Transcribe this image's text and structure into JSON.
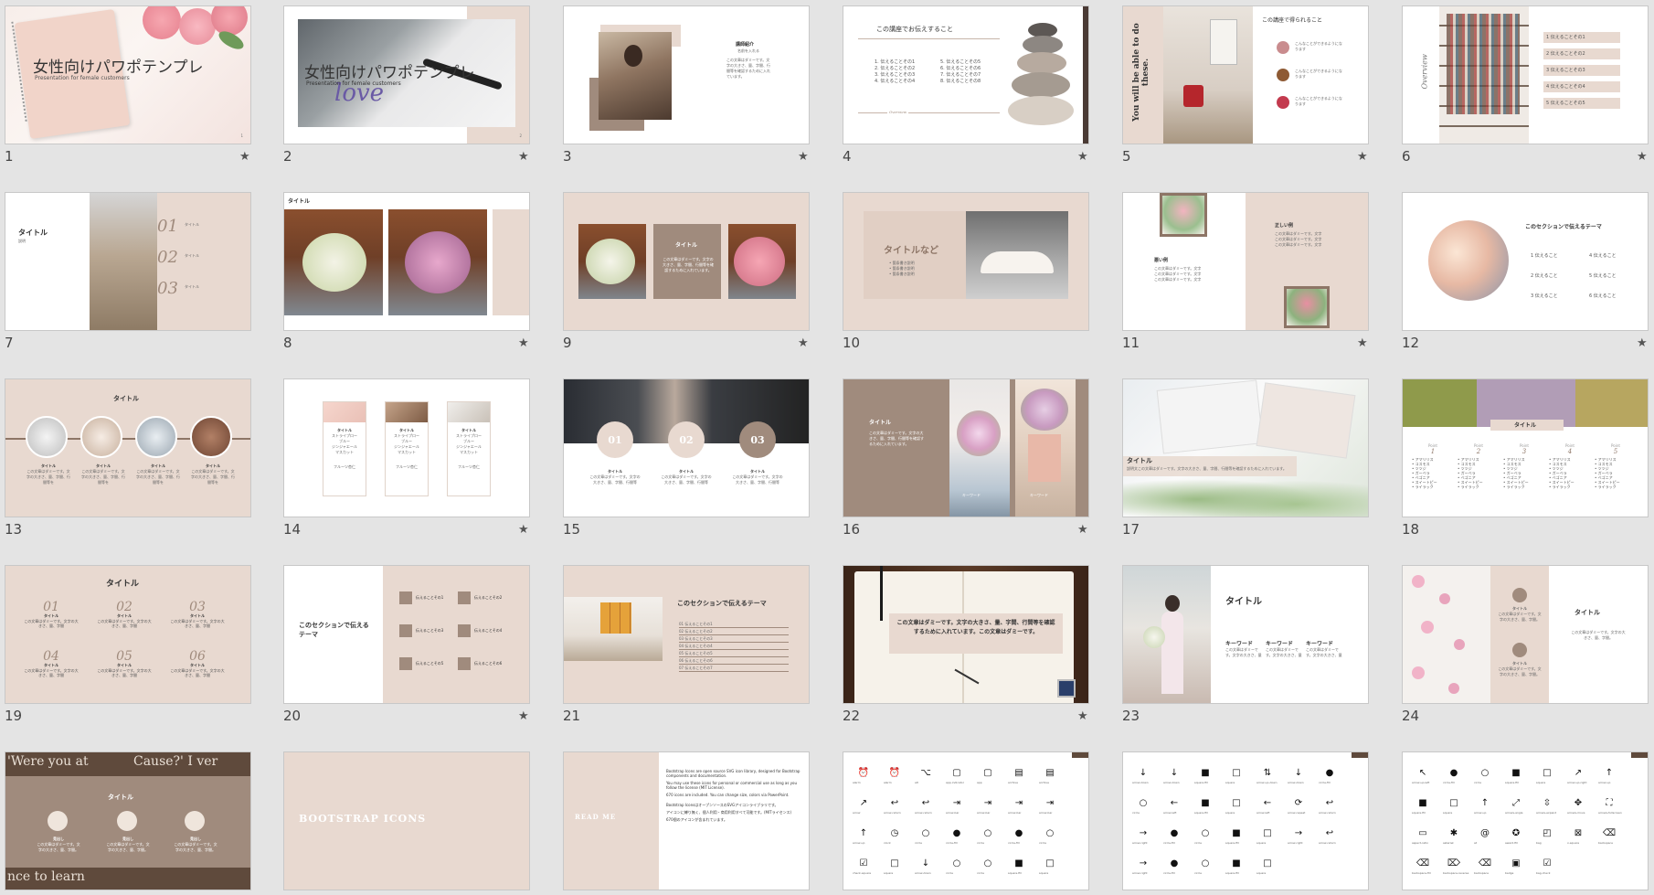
{
  "slides": [
    {
      "num": "1",
      "title": "女性向けパワポテンプレ",
      "subtitle": "Presentation for female customers",
      "page": "1"
    },
    {
      "num": "2",
      "title": "女性向けパワポテンプレ",
      "subtitle": "Presentation for female customers",
      "page": "2"
    },
    {
      "num": "3",
      "heading": "講師紹介",
      "sub": "名前を入れる",
      "body": "この文章はダミーです。文字の大きさ、量、字間、行間等を確認するために入れています。"
    },
    {
      "num": "4",
      "heading": "この講座でお伝えすること",
      "items_left": [
        "1. 伝えることその1",
        "2. 伝えることその2",
        "3. 伝えることその3",
        "4. 伝えることその4"
      ],
      "items_right": [
        "5. 伝えることその5",
        "6. 伝えることその6",
        "7. 伝えることその7",
        "8. 伝えることその8"
      ],
      "footer": "Overview"
    },
    {
      "num": "5",
      "side": "You will be able to do these.",
      "heading": "この講座で得られること",
      "items": [
        "こんなことができるようになります",
        "こんなことができるようになります",
        "こんなことができるようになります"
      ]
    },
    {
      "num": "6",
      "side": "Overview",
      "items": [
        "1 伝えることその1",
        "2 伝えることその2",
        "3 伝えることその3",
        "4 伝えることその4",
        "5 伝えることその5"
      ]
    },
    {
      "num": "7",
      "title": "タイトル",
      "sub": "説明",
      "items": [
        "01",
        "02",
        "03"
      ],
      "item_label": "タイトル"
    },
    {
      "num": "8",
      "title": "タイトル"
    },
    {
      "num": "9",
      "title": "タイトル",
      "body": "この文章はダミーです。文字の大きさ、量、字間、行間等を確認するために入れています。"
    },
    {
      "num": "10",
      "title": "タイトルなど",
      "items": [
        "箇条書き説明",
        "箇条書き説明",
        "箇条書き説明"
      ]
    },
    {
      "num": "11",
      "bad": "悪い例",
      "good": "正しい例",
      "line": "この文章はダミーです。文字"
    },
    {
      "num": "12",
      "heading": "このセクションで伝えるテーマ",
      "items": [
        "1 伝えること",
        "2 伝えること",
        "3 伝えること",
        "4 伝えること",
        "5 伝えること",
        "6 伝えること"
      ]
    },
    {
      "num": "13",
      "title": "タイトル",
      "label": "タイトル",
      "body": "この文章はダミーです。文字の大きさ、量、字間、行間等を"
    },
    {
      "num": "14",
      "label": "タイトル",
      "lines": [
        "ストライプロー",
        "ブルー",
        "ジンジャエール",
        "マスカット"
      ],
      "footer": "フルーツ杏仁"
    },
    {
      "num": "15",
      "items": [
        "01",
        "02",
        "03"
      ],
      "label": "タイトル",
      "body": "この文章はダミーです。文字の大きさ、量、字間、行間等"
    },
    {
      "num": "16",
      "title": "タイトル",
      "body": "この文章はダミーです。文字の大きさ、量、字間、行間等を確認するために入れています。",
      "captions": [
        "キーワード",
        "キーワード"
      ]
    },
    {
      "num": "17",
      "title": "タイトル",
      "body": "説明文この文章はダミーです。文字の大きさ、量、字間、行間等を確認するために入れています。"
    },
    {
      "num": "18",
      "title": "タイトル",
      "cols": [
        "1",
        "2",
        "3",
        "4",
        "5"
      ],
      "col_head": "Point",
      "lines": [
        "アマリリス",
        "コスモス",
        "ツツジ",
        "ガーベラ",
        "ベゴニア",
        "スイートピー",
        "ライラック"
      ]
    },
    {
      "num": "19",
      "title": "タイトル",
      "items": [
        "01",
        "02",
        "03",
        "04",
        "05",
        "06"
      ],
      "label": "タイトル",
      "body": "この文章はダミーです。文字の大きさ、量、字間"
    },
    {
      "num": "20",
      "heading": "このセクションで伝えるテーマ",
      "items": [
        "伝えることその1",
        "伝えることその2",
        "伝えることその3",
        "伝えることその4",
        "伝えることその5",
        "伝えることその6"
      ]
    },
    {
      "num": "21",
      "heading": "このセクションで伝えるテーマ",
      "items": [
        "01 伝えることその1",
        "02 伝えることその2",
        "03 伝えることその3",
        "04 伝えることその4",
        "05 伝えることその5",
        "06 伝えることその6",
        "07 伝えることその7"
      ]
    },
    {
      "num": "22",
      "body": "この文章はダミーです。文字の大きさ、量、字間、行間等を確認するために入れています。この文章はダミーです。"
    },
    {
      "num": "23",
      "title": "タイトル",
      "kw": "キーワード",
      "body": "この文章はダミーです。文字の大きさ、量"
    },
    {
      "num": "24",
      "title": "タイトル",
      "label": "タイトル",
      "body": "この文章はダミーです。文字の大きさ、量、字間。"
    },
    {
      "num": "25",
      "title": "タイトル",
      "label": "見出し",
      "body": "この文章はダミーです。文字の大きさ、量、字間。",
      "bg_text_1": "'Were you at",
      "bg_text_2": "nce to learn",
      "bg_text_3": "Cause?' I ver"
    },
    {
      "num": "26",
      "title": "BOOTSTRAP ICONS"
    },
    {
      "num": "27",
      "title": "READ ME",
      "bullets": [
        "Bootstrap Icons are open source SVG icon library, designed for Bootstrap components and documentation.",
        "You may use these icons for personal or commercial use as long as you follow the license (MIT License).",
        "670 icons are included. You can change size, colors via PowerPoint.",
        "Bootstrap IconsはオープンソースのSVGアイコンライブラリです。",
        "アイコンに縛り無く、個人利用・商用利用すべて可能です。(MITライセンス)",
        "670個のアイコンが含まれています。"
      ]
    },
    {
      "num": "28",
      "icons": [
        "alarm",
        "alarm",
        "alt",
        "app-indicator",
        "app",
        "archive",
        "archive",
        "arrow",
        "arrow-return",
        "arrow-return",
        "arrow-bar",
        "arrow-bar",
        "arrow-bar",
        "arrow-bar",
        "arrow-up",
        "clock",
        "circle",
        "circle-fill",
        "circle",
        "circle-fill",
        "circle",
        "check-square",
        "square",
        "arrow-down",
        "circle",
        "circle",
        "square-fill",
        "square"
      ]
    },
    {
      "num": "29",
      "icons": [
        "arrow-down",
        "arrow-down",
        "square-fill",
        "square",
        "arrow-up-down",
        "arrow-down",
        "circle-fill",
        "circle",
        "arrow-left",
        "square-fill",
        "square",
        "arrow-left",
        "arrow-repeat",
        "arrow-return",
        "arrow-right",
        "circle-fill",
        "circle",
        "square-fill",
        "square",
        "arrow-right",
        "arrow-return",
        "arrow-right",
        "circle-fill",
        "circle",
        "square-fill",
        "square"
      ]
    },
    {
      "num": "30",
      "icons": [
        "arrow-up-left",
        "circle-fill",
        "circle",
        "square-fill",
        "square",
        "arrow-up-right",
        "arrow-up",
        "square-fill",
        "square",
        "arrow-up",
        "arrows-angle",
        "arrows-expand",
        "arrows-move",
        "arrows-fullscreen",
        "aspect-ratio",
        "asterisk",
        "at",
        "award-fill",
        "bag",
        "x-square",
        "backspace",
        "backspace-fill",
        "backspace-reverse",
        "backspace",
        "badge",
        "bag-check"
      ]
    }
  ],
  "star": "★",
  "colors": {
    "beige": "#e8d9d0",
    "brown": "#a08b7d",
    "dark_brown": "#8d7566"
  }
}
